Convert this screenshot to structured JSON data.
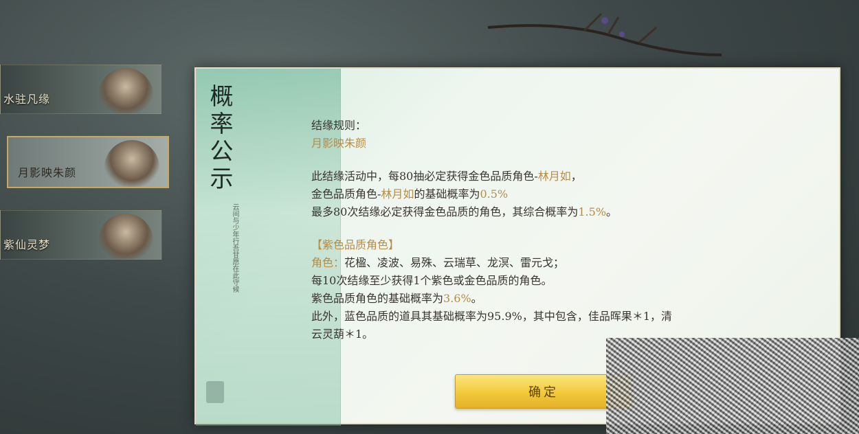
{
  "banners": [
    {
      "label": "水驻凡缘"
    },
    {
      "label": "月影映朱颜"
    },
    {
      "label": "紫仙灵梦"
    }
  ],
  "dialog": {
    "title": "概率公示",
    "subtitle": "云间与少年行吾甘愿在此守候",
    "rules_label": "结缘规则：",
    "event_name": "月影映朱颜",
    "line1_a": "此结缘活动中，每80抽必定获得金色品质角色-",
    "line1_name": "林月如",
    "line1_b": "，",
    "line2_a": "金色品质角色-",
    "line2_name": "林月如",
    "line2_b": "的基础概率为",
    "line2_rate": "0.5%",
    "line3_a": "最多80次结缘必定获得金色品质的角色，其综合概率为",
    "line3_rate": "1.5%",
    "line3_b": "。",
    "purple_header": "【紫色品质角色】",
    "purple_roles_label": "角色：",
    "purple_roles": "花楹、凌波、易殊、云瑞草、龙溟、雷元戈；",
    "purple_line2": "每10次结缘至少获得1个紫色或金色品质的角色。",
    "purple_line3_a": "紫色品质角色的基础概率为",
    "purple_line3_rate": "3.6%",
    "purple_line3_b": "。",
    "blue_line_a": "此外，蓝色品质的道具其基础概率为95.9%，其中包含，佳品晖果＊1，清",
    "blue_line_b": "云灵葫＊1。",
    "confirm_label": "确定"
  },
  "colors": {
    "highlight": "#b68c46",
    "button": "#f2c93a"
  }
}
